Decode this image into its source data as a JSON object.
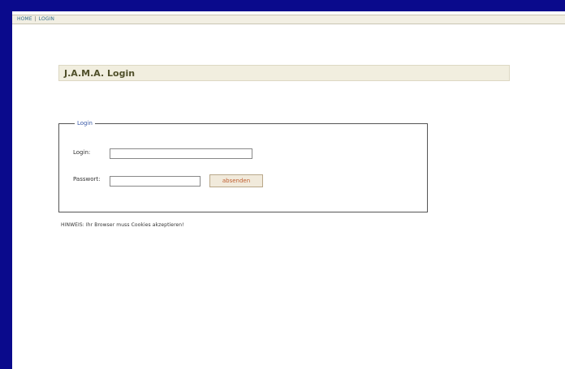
{
  "nav": {
    "home_label": "HOME",
    "separator": "|",
    "login_label": "LOGIN"
  },
  "header": {
    "title": "J.A.M.A. Login"
  },
  "login_form": {
    "legend": "Login",
    "login_label": "Login:",
    "login_value": "",
    "password_label": "Passwort:",
    "password_value": "",
    "submit_label": "absenden"
  },
  "hint": {
    "text": "HINWEIS: Ihr Browser muss Cookies akzeptieren!"
  },
  "colors": {
    "outer_background": "#0a0a8c",
    "page_background": "#ffffff",
    "bar_background": "#f1eedf",
    "link_color": "#2f6b8b",
    "legend_color": "#3a5aa8",
    "button_text": "#c06033"
  }
}
